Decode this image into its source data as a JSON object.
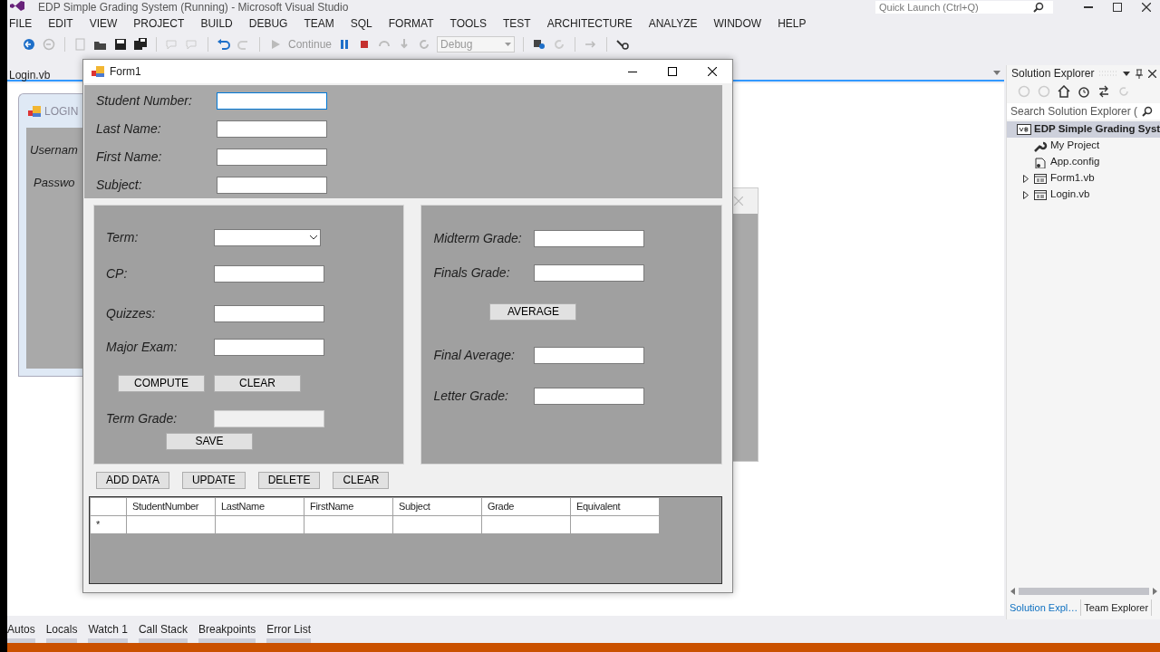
{
  "window": {
    "title": "EDP Simple Grading System (Running) - Microsoft Visual Studio"
  },
  "quick_launch": {
    "placeholder": "Quick Launch (Ctrl+Q)"
  },
  "menu": [
    "FILE",
    "EDIT",
    "VIEW",
    "PROJECT",
    "BUILD",
    "DEBUG",
    "TEAM",
    "SQL",
    "FORMAT",
    "TOOLS",
    "TEST",
    "ARCHITECTURE",
    "ANALYZE",
    "WINDOW",
    "HELP"
  ],
  "toolbar": {
    "continue_label": "Continue",
    "configuration": "Debug"
  },
  "document_tab": {
    "label": "Login.vb"
  },
  "login_window": {
    "title": "LOGIN",
    "labels": [
      "Usernam",
      "Passwo"
    ]
  },
  "form": {
    "title": "Form1",
    "student_fields": [
      {
        "label": "Student Number:",
        "focused": true
      },
      {
        "label": "Last Name:",
        "focused": false
      },
      {
        "label": "First Name:",
        "focused": false
      },
      {
        "label": "Subject:",
        "focused": false
      }
    ],
    "left_panel": [
      {
        "kind": "combo",
        "label": "Term:"
      },
      {
        "kind": "text",
        "label": "CP:",
        "disabled": false
      },
      {
        "kind": "text",
        "label": "Quizzes:",
        "disabled": false
      },
      {
        "kind": "text",
        "label": "Major Exam:",
        "disabled": false
      },
      {
        "kind": "buttons",
        "buttons": [
          "COMPUTE",
          "CLEAR"
        ]
      },
      {
        "kind": "text",
        "label": "Term Grade:",
        "disabled": true
      },
      {
        "kind": "buttons",
        "buttons": [
          "SAVE"
        ]
      }
    ],
    "right_panel": [
      {
        "kind": "text",
        "label": "Midterm Grade:",
        "disabled": false
      },
      {
        "kind": "text",
        "label": "Finals Grade:",
        "disabled": false
      },
      {
        "kind": "buttons",
        "buttons": [
          "AVERAGE"
        ]
      },
      {
        "kind": "text",
        "label": "Final Average:",
        "disabled": false
      },
      {
        "kind": "text",
        "label": "Letter Grade:",
        "disabled": false
      }
    ],
    "buttons": [
      "ADD DATA",
      "UPDATE",
      "DELETE",
      "CLEAR"
    ],
    "grid": {
      "columns": [
        "StudentNumber",
        "LastName",
        "FirstName",
        "Subject",
        "Grade",
        "Equivalent"
      ],
      "new_row_marker": "*"
    }
  },
  "solution_explorer": {
    "title": "Solution Explorer",
    "search": {
      "placeholder": "Search Solution Explorer ("
    },
    "tree": [
      {
        "label": "EDP Simple Grading Syst",
        "kind": "project",
        "selected": true,
        "children": [
          {
            "label": "My Project",
            "kind": "properties",
            "selected": false
          },
          {
            "label": "App.config",
            "kind": "config",
            "selected": false
          },
          {
            "label": "Form1.vb",
            "kind": "form",
            "selected": false,
            "expanded": false
          },
          {
            "label": "Login.vb",
            "kind": "form",
            "selected": false,
            "expanded": false
          }
        ]
      }
    ],
    "tabs": [
      {
        "label": "Solution Expl…",
        "selected": true
      },
      {
        "label": "Team Explorer",
        "selected": false
      }
    ]
  },
  "bottom_tabs": [
    "Autos",
    "Locals",
    "Watch 1",
    "Call Stack",
    "Breakpoints",
    "Error List"
  ]
}
